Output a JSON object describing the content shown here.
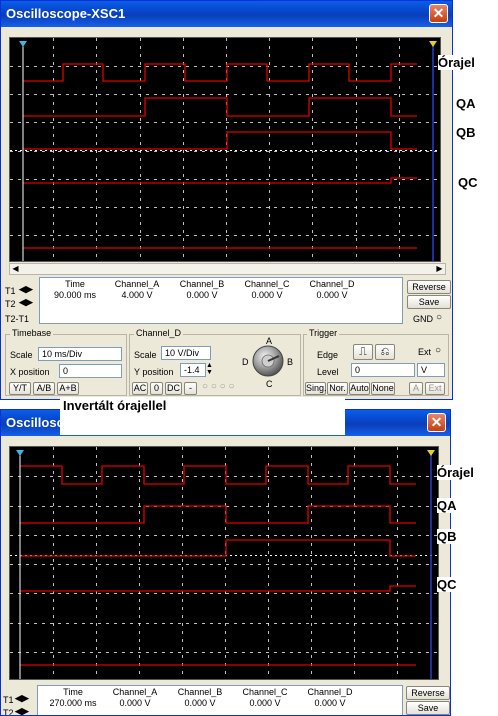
{
  "window1": {
    "title": "Oscilloscope-XSC1",
    "close_glyph": "✕",
    "readout": {
      "headers": [
        "Time",
        "Channel_A",
        "Channel_B",
        "Channel_C",
        "Channel_D"
      ],
      "t1": [
        "90.000 ms",
        "4.000 V",
        "0.000 V",
        "0.000 V",
        "0.000 V"
      ],
      "t2": [
        "",
        "",
        "",
        "",
        ""
      ],
      "t2t1": [
        "",
        "",
        "",
        "",
        ""
      ]
    },
    "row_labels": {
      "t1": "T1",
      "t2": "T2",
      "t2t1": "T2-T1"
    },
    "buttons": {
      "reverse": "Reverse",
      "save": "Save",
      "gnd": "GND"
    },
    "timebase": {
      "label": "Timebase",
      "scale_label": "Scale",
      "scale_value": "10 ms/Div",
      "xpos_label": "X position",
      "xpos_value": "0",
      "modes": [
        "Y/T",
        "A/B",
        "A+B"
      ]
    },
    "channel": {
      "label": "Channel_D",
      "scale_label": "Scale",
      "scale_value": "10  V/Div",
      "ypos_label": "Y position",
      "ypos_value": "-1.4",
      "coupling": [
        "AC",
        "0",
        "DC",
        "-"
      ],
      "knob_labels": [
        "A",
        "B",
        "C",
        "D"
      ]
    },
    "trigger": {
      "label": "Trigger",
      "edge_label": "Edge",
      "ext_label": "Ext",
      "level_label": "Level",
      "level_value": "0",
      "level_unit": "V",
      "modes": [
        "Sing.",
        "Nor.",
        "Auto",
        "None"
      ],
      "source": [
        "A",
        "Ext"
      ]
    }
  },
  "window2": {
    "title": "Oscillosco",
    "close_glyph": "✕",
    "readout": {
      "headers": [
        "Time",
        "Channel_A",
        "Channel_B",
        "Channel_C",
        "Channel_D"
      ],
      "t1": [
        "270.000 ms",
        "0.000 V",
        "0.000 V",
        "0.000 V",
        "0.000 V"
      ],
      "t2": [
        "",
        "",
        "",
        "",
        ""
      ]
    },
    "row_labels": {
      "t1": "T1",
      "t2": "T2"
    },
    "buttons": {
      "reverse": "Reverse",
      "save": "Save"
    }
  },
  "caption": "Invertált órajellel",
  "labels1": [
    "Órajel",
    "QA",
    "QB",
    "QC"
  ],
  "labels2": [
    "Órajel",
    "QA",
    "QB",
    "QC"
  ],
  "colors": {
    "trace": "#e00000",
    "screen_bg": "#000000",
    "grid": "#ffffff",
    "cursor": "#2b3bd8",
    "titlebar": "#0a4fd6"
  }
}
